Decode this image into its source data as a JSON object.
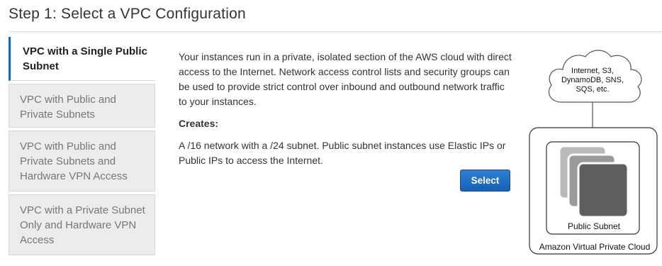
{
  "page": {
    "title": "Step 1: Select a VPC Configuration"
  },
  "sidebar": {
    "items": [
      {
        "label": "VPC with a Single Public Subnet",
        "active": true
      },
      {
        "label": "VPC with Public and Private Subnets",
        "active": false
      },
      {
        "label": "VPC with Public and Private Subnets and Hardware VPN Access",
        "active": false
      },
      {
        "label": "VPC with a Private Subnet Only and Hardware VPN Access",
        "active": false
      }
    ]
  },
  "main": {
    "description": "Your instances run in a private, isolated section of the AWS cloud with direct access to the Internet. Network access control lists and security groups can be used to provide strict control over inbound and outbound network traffic to your instances.",
    "creates_label": "Creates:",
    "creates_text": "A /16 network with a /24 subnet. Public subnet instances use Elastic IPs or Public IPs to access the Internet.",
    "select_label": "Select"
  },
  "diagram": {
    "cloud_lines": [
      "Internet, S3,",
      "DynamoDB, SNS,",
      "SQS, etc."
    ],
    "subnet_label": "Public Subnet",
    "vpc_label": "Amazon Virtual Private Cloud"
  },
  "colors": {
    "accent": "#1a66b4",
    "button": "#1560b8",
    "sidebar_bg": "#ececec"
  }
}
